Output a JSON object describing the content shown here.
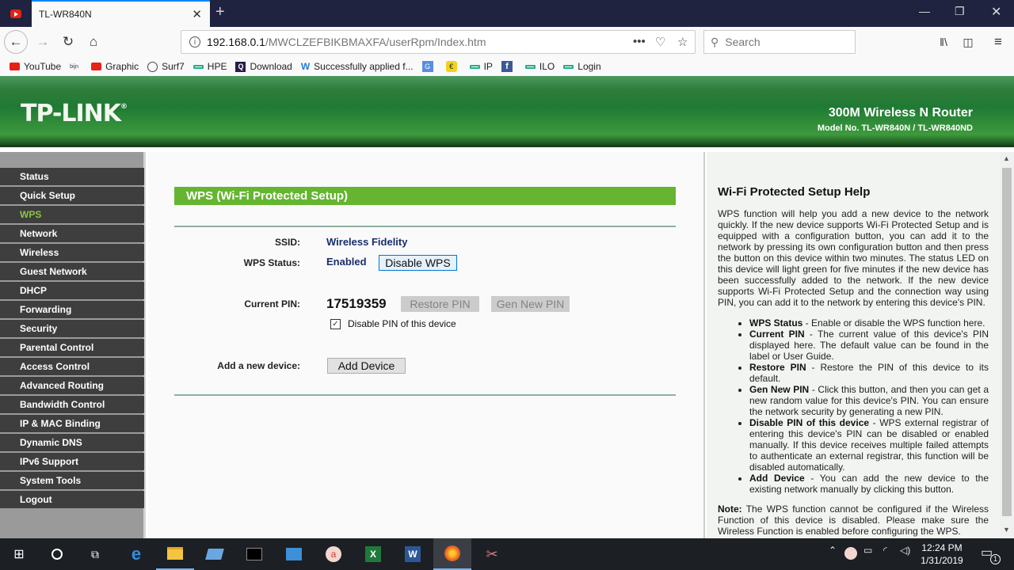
{
  "browser": {
    "tabs": [
      {
        "label": "",
        "icon": "youtube-icon"
      },
      {
        "label": "TL-WR840N",
        "active": true
      }
    ],
    "url": {
      "host": "192.168.0.1",
      "path": "/MWCLZEFBIKBMAXFA/userRpm/Index.htm"
    },
    "search_placeholder": "Search",
    "bookmarks": [
      {
        "label": "YouTube",
        "icon": "youtube-icon"
      },
      {
        "label": "",
        "icon": "bookmark-logo-icon"
      },
      {
        "label": "Graphic",
        "icon": "youtube-icon"
      },
      {
        "label": "Surf7",
        "icon": "globe-icon"
      },
      {
        "label": "HPE",
        "icon": "hpe-icon"
      },
      {
        "label": "Download",
        "icon": "q-icon"
      },
      {
        "label": "Successfully applied f...",
        "icon": "w-icon"
      },
      {
        "label": "",
        "icon": "translate-icon"
      },
      {
        "label": "",
        "icon": "emoji-icon"
      },
      {
        "label": "IP",
        "icon": "hpe-icon"
      },
      {
        "label": "",
        "icon": "facebook-icon"
      },
      {
        "label": "ILO",
        "icon": "hpe-icon"
      },
      {
        "label": "Login",
        "icon": "hpe-icon"
      }
    ]
  },
  "router": {
    "brand": "TP-LINK",
    "product_name": "300M Wireless N Router",
    "model": "Model No. TL-WR840N / TL-WR840ND",
    "accent_color": "#65b530",
    "menu": [
      {
        "label": "Status"
      },
      {
        "label": "Quick Setup"
      },
      {
        "label": "WPS",
        "active": true
      },
      {
        "label": "Network"
      },
      {
        "label": "Wireless"
      },
      {
        "label": "Guest Network"
      },
      {
        "label": "DHCP"
      },
      {
        "label": "Forwarding"
      },
      {
        "label": "Security"
      },
      {
        "label": "Parental Control"
      },
      {
        "label": "Access Control"
      },
      {
        "label": "Advanced Routing"
      },
      {
        "label": "Bandwidth Control"
      },
      {
        "label": "IP & MAC Binding"
      },
      {
        "label": "Dynamic DNS"
      },
      {
        "label": "IPv6 Support"
      },
      {
        "label": "System Tools"
      },
      {
        "label": "Logout"
      }
    ],
    "wps": {
      "title": "WPS (Wi-Fi Protected Setup)",
      "ssid_label": "SSID:",
      "ssid_value": "Wireless Fidelity",
      "status_label": "WPS Status:",
      "status_value": "Enabled",
      "disable_wps_button": "Disable WPS",
      "pin_label": "Current PIN:",
      "pin_value": "17519359",
      "restore_pin_button": "Restore PIN",
      "gen_pin_button": "Gen New PIN",
      "disable_pin_label": "Disable PIN of this device",
      "disable_pin_checked": true,
      "add_device_label": "Add a new device:",
      "add_device_button": "Add Device"
    },
    "help": {
      "title": "Wi-Fi Protected Setup Help",
      "intro": "WPS function will help you add a new device to the network quickly. If the new device supports Wi-Fi Protected Setup and is equipped with a configuration button, you can add it to the network by pressing its own configuration button and then press the button on this device within two minutes. The status LED on this device will light green for five minutes if the new device has been successfully added to the network. If the new device supports Wi-Fi Protected Setup and the connection way using PIN, you can add it to the network by entering this device's PIN.",
      "items": [
        {
          "term": "WPS Status",
          "desc": " - Enable or disable the WPS function here."
        },
        {
          "term": "Current PIN",
          "desc": " - The current value of this device's PIN displayed here. The default value can be found in the label or User Guide."
        },
        {
          "term": "Restore PIN",
          "desc": " - Restore the PIN of this device to its default."
        },
        {
          "term": "Gen New PIN",
          "desc": " - Click this button, and then you can get a new random value for this device's PIN. You can ensure the network security by generating a new PIN."
        },
        {
          "term": "Disable PIN of this device",
          "desc": " - WPS external registrar of entering this device's PIN can be disabled or enabled manually. If this device receives multiple failed attempts to authenticate an external registrar, this function will be disabled automatically."
        },
        {
          "term": "Add Device",
          "desc": " - You can add the new device to the existing network manually by clicking this button."
        }
      ],
      "note_label": "Note:",
      "note": " The WPS function cannot be configured if the Wireless Function of this device is disabled. Please make sure the Wireless Function is enabled before configuring the WPS."
    }
  },
  "taskbar": {
    "time": "12:24 PM",
    "date": "1/31/2019",
    "notification_count": "1"
  }
}
